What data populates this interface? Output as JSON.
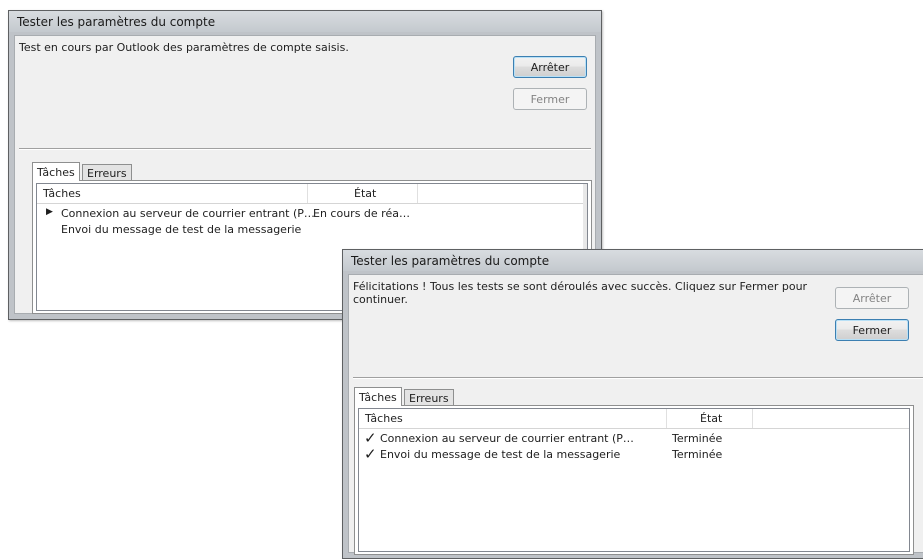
{
  "dialog1": {
    "title": "Tester les paramètres du compte",
    "message": "Test en cours par Outlook des paramètres de compte saisis.",
    "stop_button": "Arrêter",
    "close_button": "Fermer",
    "tabs": [
      "Tâches",
      "Erreurs"
    ],
    "columns": {
      "tasks": "Tâches",
      "status": "État"
    },
    "rows": [
      {
        "indicator": "arrow-right-icon",
        "task": "Connexion au serveur de courrier entrant (P…",
        "status": "En cours de réa…"
      },
      {
        "indicator": "",
        "task": "Envoi du message de test de la messagerie",
        "status": ""
      }
    ]
  },
  "dialog2": {
    "title": "Tester les paramètres du compte",
    "message_line1": "Félicitations ! Tous les tests se sont déroulés avec succès. Cliquez sur Fermer pour",
    "message_line2": "continuer.",
    "stop_button": "Arrêter",
    "close_button": "Fermer",
    "tabs": [
      "Tâches",
      "Erreurs"
    ],
    "columns": {
      "tasks": "Tâches",
      "status": "État"
    },
    "rows": [
      {
        "indicator": "checkmark-icon",
        "task": "Connexion au serveur de courrier entrant (P…",
        "status": "Terminée"
      },
      {
        "indicator": "checkmark-icon",
        "task": "Envoi du message de test de la messagerie",
        "status": "Terminée"
      }
    ]
  }
}
